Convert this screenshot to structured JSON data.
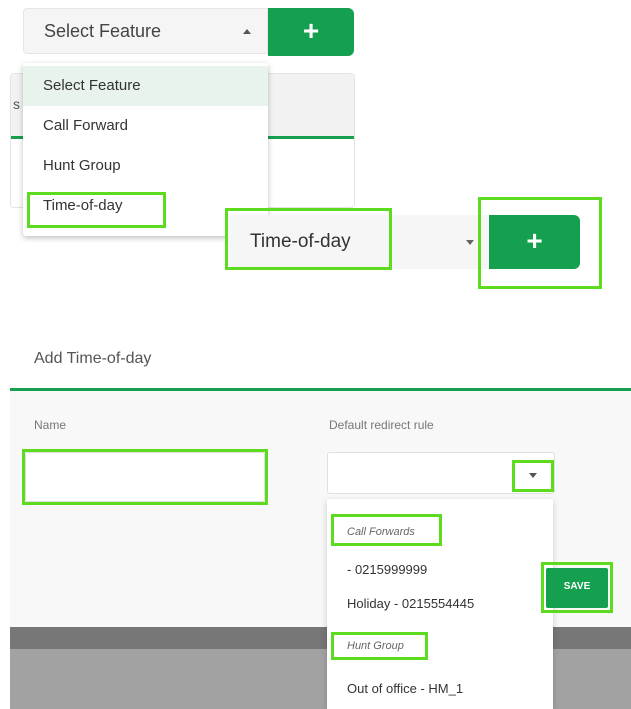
{
  "top_select": {
    "value": "Select Feature"
  },
  "add_button": {
    "label": "+"
  },
  "background_card": {
    "fragment": "s"
  },
  "feature_menu": {
    "options": [
      "Select Feature",
      "Call Forward",
      "Hunt Group",
      "Time-of-day"
    ]
  },
  "selected_feature": {
    "value": "Time-of-day"
  },
  "add_button_2": {
    "label": "+"
  },
  "add_panel": {
    "title": "Add Time-of-day",
    "name_label": "Name",
    "rule_label": "Default redirect rule"
  },
  "rule_menu": {
    "group_call_forwards": "Call Forwards",
    "opt1": "- 0215999999",
    "opt2": "Holiday - 0215554445",
    "group_hunt": "Hunt Group",
    "opt3": "Out of office - HM_1"
  },
  "save_button": {
    "label": "SAVE"
  },
  "colors": {
    "accent": "#15a04f",
    "highlight": "#5ddc1f"
  }
}
